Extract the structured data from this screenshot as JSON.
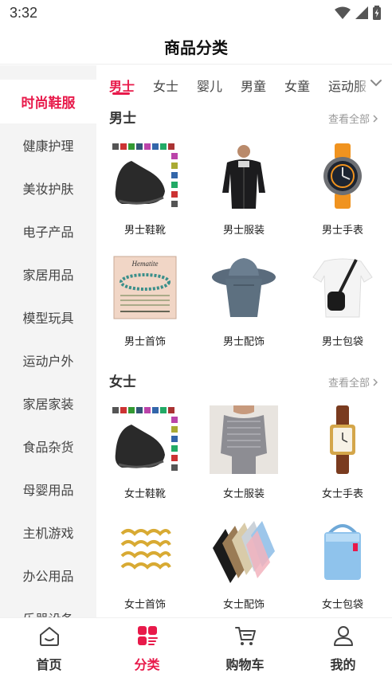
{
  "status_bar": {
    "time": "3:32"
  },
  "header": {
    "title": "商品分类"
  },
  "colors": {
    "accent": "#e8194a",
    "sidebar_bg": "#f4f4f4"
  },
  "sidebar": {
    "items": [
      {
        "label": "时尚鞋服",
        "active": true
      },
      {
        "label": "健康护理"
      },
      {
        "label": "美妆护肤"
      },
      {
        "label": "电子产品"
      },
      {
        "label": "家居用品"
      },
      {
        "label": "模型玩具"
      },
      {
        "label": "运动户外"
      },
      {
        "label": "家居家装"
      },
      {
        "label": "食品杂货"
      },
      {
        "label": "母婴用品"
      },
      {
        "label": "主机游戏"
      },
      {
        "label": "办公用品"
      },
      {
        "label": "乐器设备"
      }
    ]
  },
  "tabs": {
    "items": [
      {
        "label": "男士",
        "active": true
      },
      {
        "label": "女士"
      },
      {
        "label": "婴儿"
      },
      {
        "label": "男童"
      },
      {
        "label": "女童"
      },
      {
        "label": "运动服"
      }
    ],
    "expand_icon": "chevron-down-icon"
  },
  "sections": [
    {
      "title": "男士",
      "view_all": "查看全部",
      "products": [
        {
          "label": "男士鞋靴",
          "icon": "water-shoe"
        },
        {
          "label": "男士服装",
          "icon": "jacket"
        },
        {
          "label": "男士手表",
          "icon": "watch"
        },
        {
          "label": "男士首饰",
          "icon": "bracelet",
          "image_text": "Hematite"
        },
        {
          "label": "男士配饰",
          "icon": "hat"
        },
        {
          "label": "男士包袋",
          "icon": "sling-bag"
        }
      ]
    },
    {
      "title": "女士",
      "view_all": "查看全部",
      "products": [
        {
          "label": "女士鞋靴",
          "icon": "water-shoe"
        },
        {
          "label": "女士服装",
          "icon": "top"
        },
        {
          "label": "女士手表",
          "icon": "watch-gold"
        },
        {
          "label": "女士首饰",
          "icon": "hair-rings"
        },
        {
          "label": "女士配饰",
          "icon": "sleeves"
        },
        {
          "label": "女士包袋",
          "icon": "cooler-bag"
        }
      ]
    }
  ],
  "bottom_nav": {
    "items": [
      {
        "label": "首页",
        "icon": "home-icon"
      },
      {
        "label": "分类",
        "icon": "category-icon",
        "active": true
      },
      {
        "label": "购物车",
        "icon": "cart-icon"
      },
      {
        "label": "我的",
        "icon": "user-icon"
      }
    ]
  }
}
